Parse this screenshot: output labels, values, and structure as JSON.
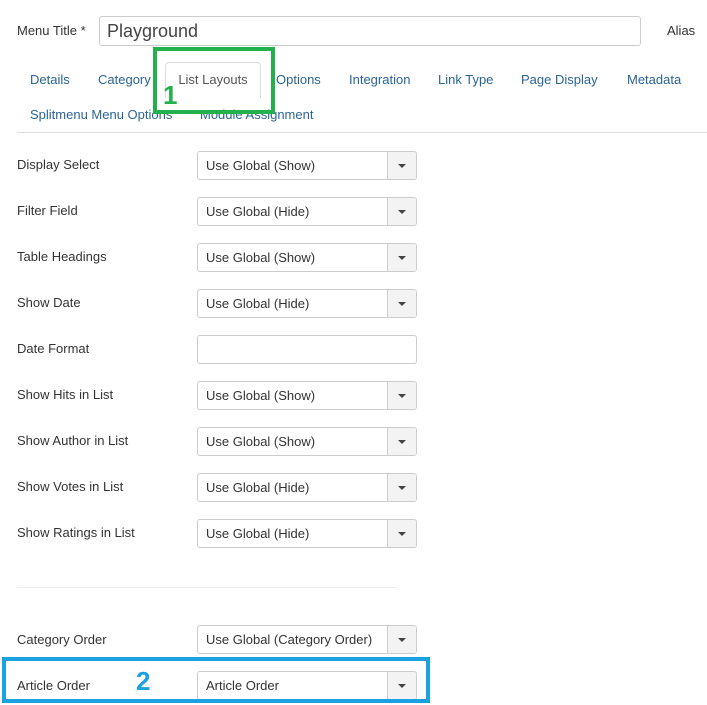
{
  "header": {
    "menu_title_label": "Menu Title *",
    "menu_title_value": "Playground",
    "alias_label": "Alias"
  },
  "tabs": [
    {
      "label": "Details"
    },
    {
      "label": "Category"
    },
    {
      "label": "List Layouts",
      "active": true
    },
    {
      "label": "Options"
    },
    {
      "label": "Integration"
    },
    {
      "label": "Link Type"
    },
    {
      "label": "Page Display"
    },
    {
      "label": "Metadata"
    },
    {
      "label": "Splitmenu Menu Options"
    },
    {
      "label": "Module Assignment"
    }
  ],
  "fields": {
    "display_select": {
      "label": "Display Select",
      "value": "Use Global (Show)"
    },
    "filter_field": {
      "label": "Filter Field",
      "value": "Use Global (Hide)"
    },
    "table_headings": {
      "label": "Table Headings",
      "value": "Use Global (Show)"
    },
    "show_date": {
      "label": "Show Date",
      "value": "Use Global (Hide)"
    },
    "date_format": {
      "label": "Date Format",
      "value": ""
    },
    "show_hits": {
      "label": "Show Hits in List",
      "value": "Use Global (Show)"
    },
    "show_author": {
      "label": "Show Author in List",
      "value": "Use Global (Show)"
    },
    "show_votes": {
      "label": "Show Votes in List",
      "value": "Use Global (Hide)"
    },
    "show_ratings": {
      "label": "Show Ratings in List",
      "value": "Use Global (Hide)"
    },
    "category_order": {
      "label": "Category Order",
      "value": "Use Global (Category Order)"
    },
    "article_order": {
      "label": "Article Order",
      "value": "Article Order"
    }
  },
  "annotations": {
    "marker_1": "1",
    "marker_2": "2",
    "color_1": "#22b14c",
    "color_2": "#1ba1e2"
  },
  "icons": {
    "dropdown": "caret-down-icon"
  }
}
